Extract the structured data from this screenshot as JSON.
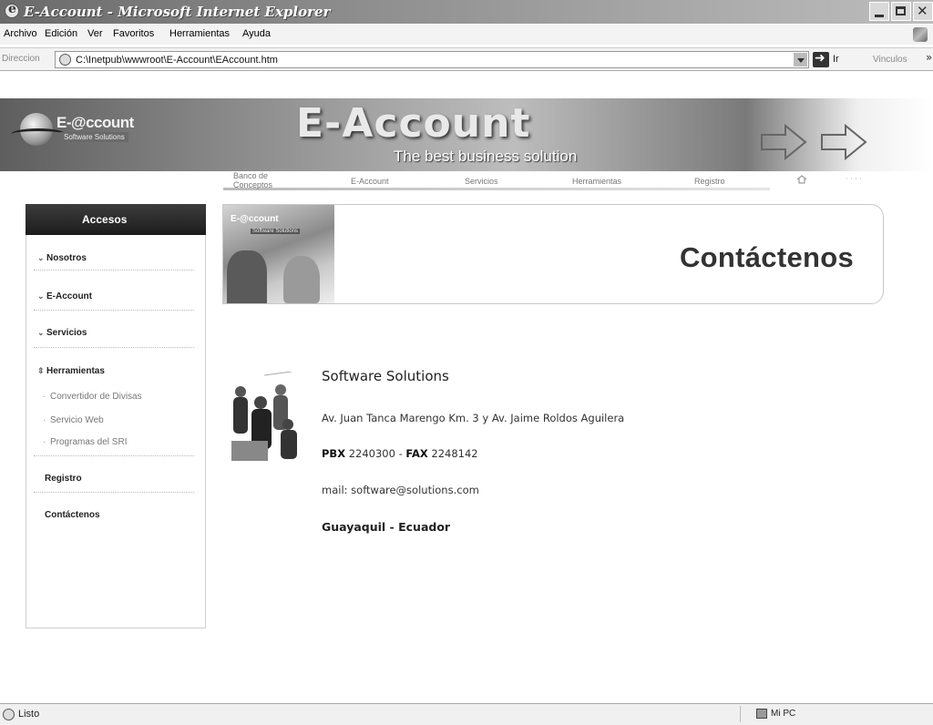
{
  "window": {
    "title": "E-Account - Microsoft Internet Explorer"
  },
  "menu": [
    "Archivo",
    "Edición",
    "Ver",
    "Favoritos",
    "Herramientas",
    "Ayuda"
  ],
  "address_bar": {
    "label": "Direccion",
    "url": "C:\\Inetpub\\wwwroot\\E-Account\\EAccount.htm",
    "go_label": "Ir",
    "links_label": "Vinculos",
    "more": "»"
  },
  "banner": {
    "logo_text": "E-@ccount",
    "logo_sub": "Software Solutions",
    "title": "E-Account",
    "tagline": "The best business solution"
  },
  "nav": {
    "tabs": [
      {
        "label": "Banco de\nConceptos"
      },
      {
        "label": "E-Account"
      },
      {
        "label": "Servicios"
      },
      {
        "label": "Herramientas"
      },
      {
        "label": "Registro"
      }
    ]
  },
  "sidebar": {
    "header": "Accesos",
    "items": [
      {
        "label": "Nosotros"
      },
      {
        "label": "E-Account"
      },
      {
        "label": "Servicios"
      },
      {
        "label": "Herramientas"
      }
    ],
    "subitems": [
      {
        "label": "Convertidor de Divisas"
      },
      {
        "label": "Servicio Web"
      },
      {
        "label": "Programas del SRI"
      }
    ],
    "plain_items": [
      {
        "label": "Registro"
      },
      {
        "label": "Contáctenos"
      }
    ]
  },
  "content": {
    "header_logo": "E-@ccount",
    "header_logo_sub": "Software Solutions",
    "title": "Contáctenos"
  },
  "contact": {
    "company": "Software Solutions",
    "address": "Av. Juan Tanca Marengo Km. 3 y Av. Jaime Roldos Aguilera",
    "pbx_label": "PBX",
    "pbx_value": "2240300",
    "phone_sep": "-",
    "fax_label": "FAX",
    "fax_value": "2248142",
    "mail": "mail: software@solutions.com",
    "city": "Guayaquil - Ecuador"
  },
  "status": {
    "text": "Listo",
    "zone": "Mi PC"
  }
}
